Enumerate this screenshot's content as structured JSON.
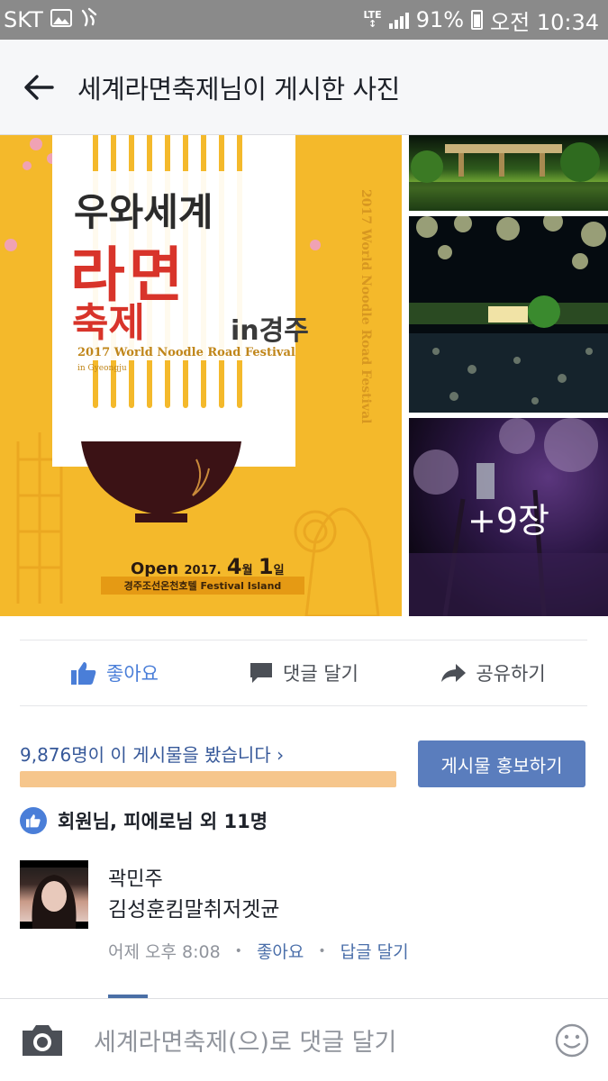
{
  "status_bar": {
    "carrier": "SKT",
    "network": "LTE",
    "battery": "91%",
    "time": "오전 10:34",
    "icons": [
      "image-icon",
      "gesture-icon",
      "signal-icon",
      "battery-icon"
    ]
  },
  "header": {
    "title": "세계라면축제님이 게시한 사진"
  },
  "photos": {
    "poster": {
      "title_line1": "우와세계",
      "title_line2": "라면",
      "title_line3": "축제",
      "title_line3_suffix": "in경주",
      "english_line1": "2017 World Noodle Road Festival",
      "english_line2": "in Gyeongju",
      "open_label": "Open",
      "open_year": "2017.",
      "open_month": "4",
      "open_month_unit": "월",
      "open_day": "1",
      "open_day_unit": "일",
      "venue": "경주조선온천호텔 Festival Island",
      "side_text": "2017 World Noodle Road Festival"
    },
    "more_count": "+9장"
  },
  "actions": {
    "like": "좋아요",
    "comment": "댓글 달기",
    "share": "공유하기"
  },
  "insights": {
    "reach_text": "9,876명이 이 게시물을 봤습니다 ›",
    "reach_bar_fraction": 1.0,
    "boost_button": "게시물 홍보하기"
  },
  "likes_summary": "회원님, 피에로님 외 11명",
  "comment": {
    "author": "곽민주",
    "text": "김성훈킴말취저겟균",
    "time": "어제 오후 8:08",
    "like_action": "좋아요",
    "reply_action": "답글 달기"
  },
  "composer": {
    "placeholder": "세계라면축제(으)로 댓글 달기"
  },
  "colors": {
    "accent": "#4a7ed8",
    "boost": "#5a7dbd",
    "reach_bar": "#f6c68c",
    "poster_bg": "#f4b92b",
    "poster_red": "#d8342a"
  }
}
